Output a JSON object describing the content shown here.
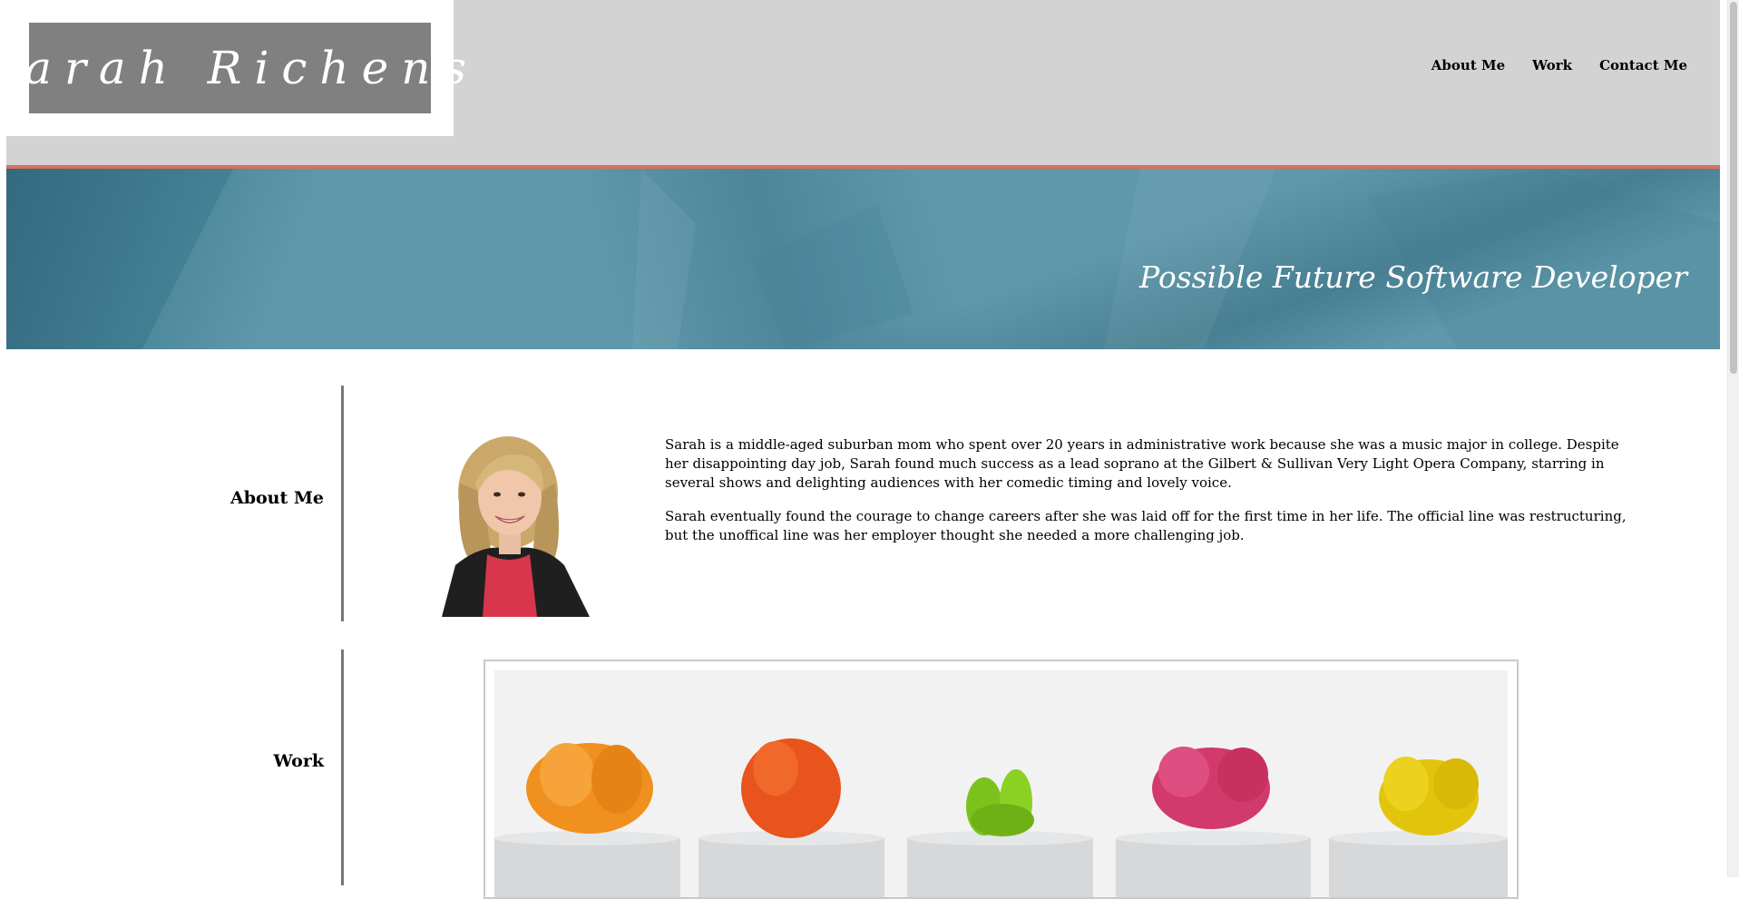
{
  "header": {
    "logo_text": "Sarah Richens",
    "nav": [
      {
        "label": "About Me"
      },
      {
        "label": "Work"
      },
      {
        "label": "Contact Me"
      }
    ]
  },
  "banner": {
    "tagline": "Possible Future Software Developer"
  },
  "about": {
    "label": "About Me",
    "paragraphs": [
      "Sarah is a middle-aged suburban mom who spent over 20 years in administrative work because she was a music major in college. Despite her disappointing day job, Sarah found much success as a lead soprano at the Gilbert & Sullivan Very Light Opera Company, starring in several shows and delighting audiences with her comedic timing and lovely voice.",
      "Sarah eventually found the courage to change careers after she was laid off for the first time in her life. The official line was restructuring, but the unoffical line was her employer thought she needed a more challenging job."
    ]
  },
  "work": {
    "label": "Work"
  },
  "colors": {
    "header_bg": "#d3d3d3",
    "accent_line": "#d9705f",
    "banner_blue": "#5e98aa",
    "logo_box": "#808080"
  }
}
